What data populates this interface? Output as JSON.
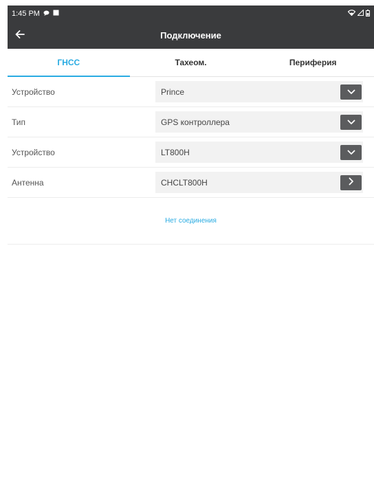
{
  "status_bar": {
    "time": "1:45 PM"
  },
  "toolbar": {
    "title": "Подключение"
  },
  "tabs": [
    {
      "label": "ГНСС",
      "active": true
    },
    {
      "label": "Тахеом.",
      "active": false
    },
    {
      "label": "Периферия",
      "active": false
    }
  ],
  "rows": [
    {
      "label": "Устройство",
      "value": "Prince",
      "action_icon": "chevron-down-icon"
    },
    {
      "label": "Тип",
      "value": "GPS контроллера",
      "action_icon": "chevron-down-icon"
    },
    {
      "label": "Устройство",
      "value": "LT800H",
      "action_icon": "chevron-down-icon"
    },
    {
      "label": "Антенна",
      "value": "CHCLT800H",
      "action_icon": "chevron-right-icon"
    }
  ],
  "connection_status": "Нет соединения",
  "colors": {
    "accent": "#29abe2",
    "appbar": "#3a3b3d",
    "button": "#5b5c5e"
  }
}
